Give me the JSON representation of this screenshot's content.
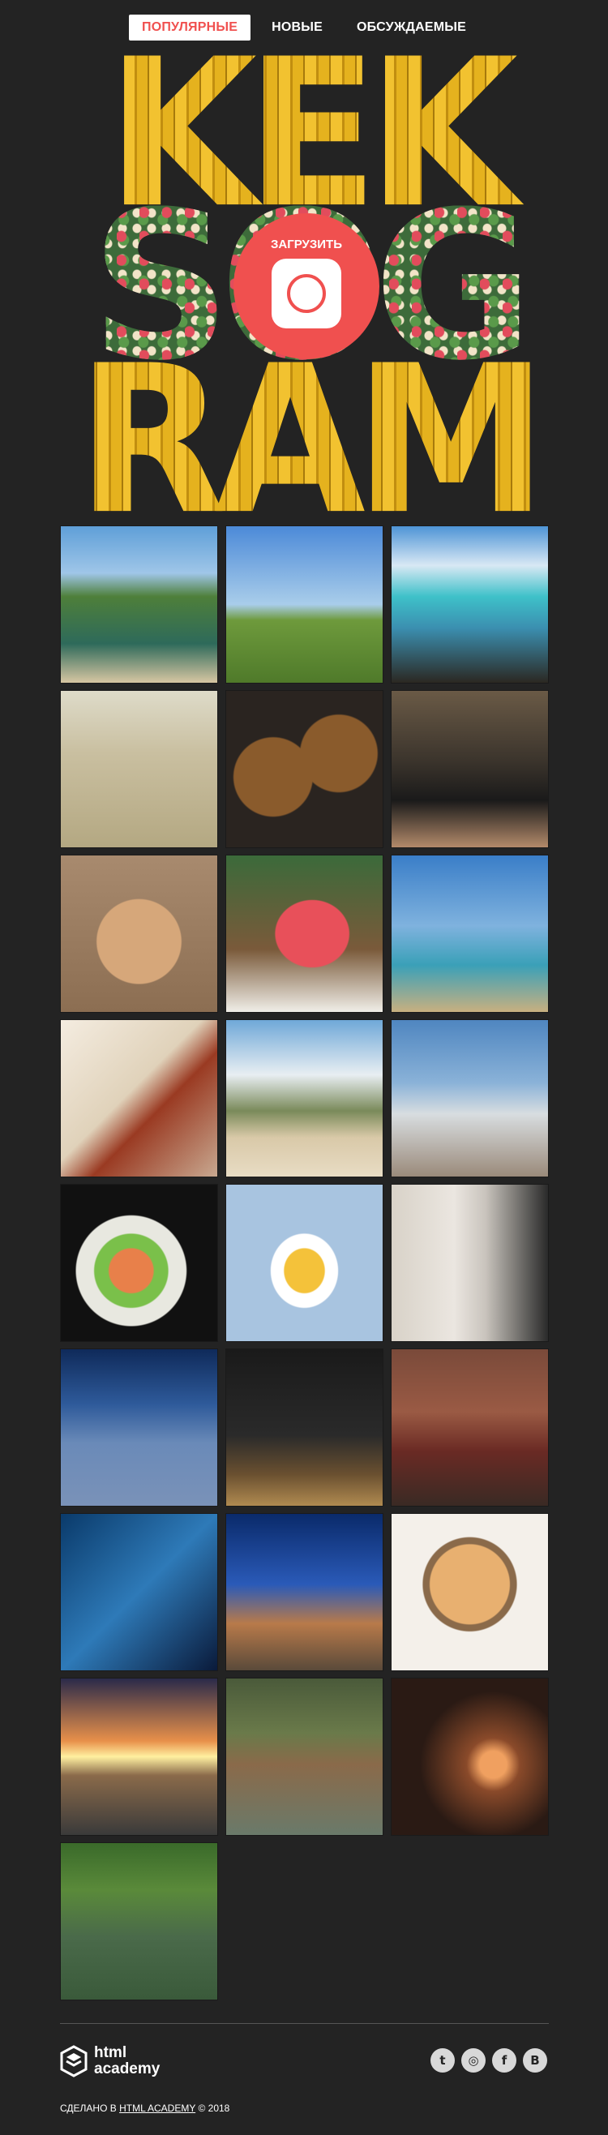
{
  "filters": [
    {
      "label": "Популярные",
      "active": true
    },
    {
      "label": "Новые",
      "active": false
    },
    {
      "label": "Обсуждаемые",
      "active": false
    }
  ],
  "hero": {
    "logo_lines": [
      "KEK",
      "SOG",
      "RAM"
    ],
    "upload_label": "Загрузить"
  },
  "photos": [
    {
      "name": "photo-lake-park",
      "bg": "linear-gradient(#5f9fd8 0%, #9fc6e8 30%, #4e7f3a 45%, #2e6a5a 75%, #d7c6a2 100%)"
    },
    {
      "name": "photo-beach-sign",
      "bg": "linear-gradient(#4c8ad8 0%, #a9cdea 50%, #6e9a3c 60%, #4f7a2a 100%)"
    },
    {
      "name": "photo-rocky-sea",
      "bg": "linear-gradient(#4e94d6 0%, #d8e8f4 25%, #3ec1c9 45%, #3b8fb0 65%, #2b2822 100%)"
    },
    {
      "name": "photo-girl-camera",
      "bg": "linear-gradient(#dedbc9 0%, #c9bfa0 40%, #b4a882 100%)"
    },
    {
      "name": "photo-snowmen-soup",
      "bg": "radial-gradient(circle at 30% 55%, #8a5b2c 0 28%, transparent 29%), radial-gradient(circle at 72% 40%, #8a5b2c 0 26%, transparent 27%), #2a2420"
    },
    {
      "name": "photo-black-car",
      "bg": "linear-gradient(#6a5a46 0%, #3b342c 45%, #1a1a1a 70%, #b38a6a 100%)"
    },
    {
      "name": "photo-strawberry-plate",
      "bg": "radial-gradient(circle at 50% 55%, #d6a77a 0 36%, transparent 37%), linear-gradient(#a88a6e, #8c6e52)"
    },
    {
      "name": "photo-red-drink",
      "bg": "radial-gradient(ellipse at 55% 50%, #e8505a 0 30%, transparent 31%), linear-gradient(#3b6a3a, #7a5a3a 60%, #f0eee8)"
    },
    {
      "name": "photo-girl-airplane",
      "bg": "linear-gradient(#3a7ec8 0%, #7fb2de 45%, #3aa0b8 70%, #c8b080 100%)"
    },
    {
      "name": "photo-cutlery-drawer",
      "bg": "linear-gradient(135deg, #f4ece0 0%, #e0d2ba 45%, #9a3a22 60%, #c8a890 100%)"
    },
    {
      "name": "photo-dunes-path",
      "bg": "linear-gradient(#6fa8d8 0%, #e8eef2 35%, #7a8a5a 58%, #d9c9a8 75%, #e8dcc4 100%)"
    },
    {
      "name": "photo-white-audi",
      "bg": "linear-gradient(#4f86c0 0%, #8ab2d8 40%, #d8dde0 60%, #9a8a7a 100%)"
    },
    {
      "name": "photo-salad-plate",
      "bg": "radial-gradient(circle at 45% 55%, #e8804a 0 18%, #7ac04a 19% 30%, #e8e8e0 31% 45%, transparent 46%), #111"
    },
    {
      "name": "photo-sushi-cat",
      "bg": "radial-gradient(ellipse at 50% 55%, #f4c23a 0 18%, #ffffff 19% 30%, transparent 31%), #a8c4e0"
    },
    {
      "name": "photo-robot-slippers",
      "bg": "linear-gradient(90deg, #d8d2c8 0%, #ebe6e0 40%, #c9c4bd 60%, #2a2a2a 100%)"
    },
    {
      "name": "photo-clouds-from-plane",
      "bg": "linear-gradient(#0f2a5a 0%, #2e5a9a 35%, #6a8ab8 60%, #7a92b8 100%)"
    },
    {
      "name": "photo-choir-stage",
      "bg": "linear-gradient(#1a1a1a 0%, #2a2a2a 55%, #6a5030 80%, #b08a50 100%)"
    },
    {
      "name": "photo-red-lowrider",
      "bg": "linear-gradient(#7a4a3a 0%, #9a5a44 40%, #6a2a24 65%, #3a2a24 100%)"
    },
    {
      "name": "photo-blue-feet-light",
      "bg": "linear-gradient(135deg, #0a3a6a 0%, #2e7ab8 50%, #0a1a3a 100%)"
    },
    {
      "name": "photo-palm-trees-night",
      "bg": "linear-gradient(#0a2a6a 0%, #2a5ab8 45%, #b87a4a 70%, #5a4a3a 100%)"
    },
    {
      "name": "photo-pasta-bowl",
      "bg": "radial-gradient(circle at 50% 45%, #e8b070 0 34%, #8a6a4a 35% 40%, transparent 41%), #f4f0ea"
    },
    {
      "name": "photo-sunset-sea",
      "bg": "linear-gradient(#2a2a4a 0%, #e8904a 40%, #fff0a0 50%, #8a6a4a 62%, #3a3a3a 100%)"
    },
    {
      "name": "photo-crab-rock",
      "bg": "linear-gradient(#4a5a3a 0%, #6a7a4a 35%, #8a6a4a 55%, #6a7a6a 100%)"
    },
    {
      "name": "photo-concert-crowd",
      "bg": "radial-gradient(circle at 65% 55%, #f0a060 0 10%, #8a4a2a 20%, #2a1a14 55%)"
    },
    {
      "name": "photo-jeep-river",
      "bg": "linear-gradient(#3a6a2a 0%, #5a8a3a 30%, #4a6a4a 60%, #3a5a3a 100%)"
    }
  ],
  "footer": {
    "logo_line1": "html",
    "logo_line2": "academy",
    "social": [
      {
        "name": "twitter-icon",
        "glyph": "t"
      },
      {
        "name": "instagram-icon",
        "glyph": "◎"
      },
      {
        "name": "facebook-icon",
        "glyph": "f"
      },
      {
        "name": "vk-icon",
        "glyph": "B"
      }
    ],
    "copyright_prefix": "Сделано в",
    "copyright_link": "HTML Academy",
    "copyright_suffix": "© 2018"
  }
}
